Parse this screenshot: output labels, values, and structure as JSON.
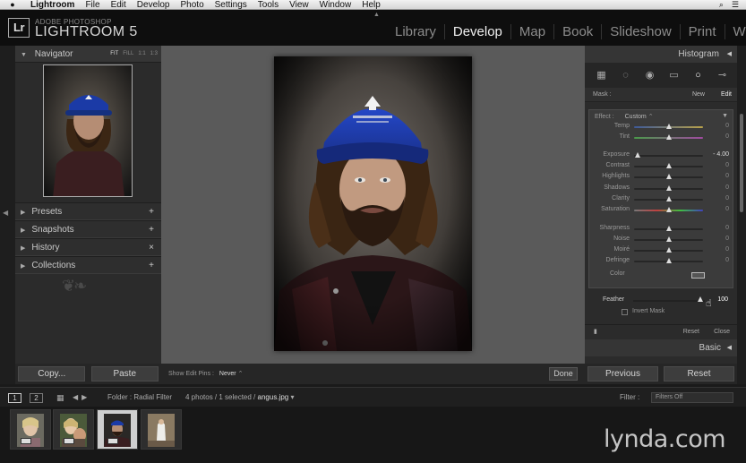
{
  "menubar": {
    "app": "Lightroom",
    "items": [
      "File",
      "Edit",
      "Develop",
      "Photo",
      "Settings",
      "Tools",
      "View",
      "Window",
      "Help"
    ]
  },
  "header": {
    "badge": "Lr",
    "brand_top": "ADOBE PHOTOSHOP",
    "brand_main": "LIGHTROOM 5",
    "modules": [
      {
        "label": "Library",
        "active": false
      },
      {
        "label": "Develop",
        "active": true
      },
      {
        "label": "Map",
        "active": false
      },
      {
        "label": "Book",
        "active": false
      },
      {
        "label": "Slideshow",
        "active": false
      },
      {
        "label": "Print",
        "active": false
      },
      {
        "label": "Web",
        "active": false
      }
    ]
  },
  "left_panel": {
    "navigator": {
      "title": "Navigator",
      "zoom": [
        "FIT",
        "FILL",
        "1:1",
        "1:3"
      ]
    },
    "sections": [
      {
        "label": "Presets",
        "action": "+"
      },
      {
        "label": "Snapshots",
        "action": "+"
      },
      {
        "label": "History",
        "action": "×"
      },
      {
        "label": "Collections",
        "action": "+"
      }
    ],
    "copy_label": "Copy...",
    "paste_label": "Paste"
  },
  "center": {
    "show_pins_label": "Show Edit Pins :",
    "show_pins_value": "Never",
    "done_label": "Done"
  },
  "right_panel": {
    "histogram_title": "Histogram",
    "mask": {
      "label": "Mask :",
      "new": "New",
      "edit": "Edit"
    },
    "effect": {
      "label": "Effect :",
      "value": "Custom"
    },
    "sliders": [
      {
        "label": "Temp",
        "pos": 0.5,
        "value": "0"
      },
      {
        "label": "Tint",
        "pos": 0.5,
        "value": "0"
      },
      {
        "label": "Exposure",
        "pos": 0.05,
        "value": "- 4.00",
        "hi": true
      },
      {
        "label": "Contrast",
        "pos": 0.5,
        "value": "0"
      },
      {
        "label": "Highlights",
        "pos": 0.5,
        "value": "0"
      },
      {
        "label": "Shadows",
        "pos": 0.5,
        "value": "0"
      },
      {
        "label": "Clarity",
        "pos": 0.5,
        "value": "0"
      },
      {
        "label": "Saturation",
        "pos": 0.5,
        "value": "0"
      },
      {
        "label": "Sharpness",
        "pos": 0.5,
        "value": "0"
      },
      {
        "label": "Noise",
        "pos": 0.5,
        "value": "0"
      },
      {
        "label": "Moiré",
        "pos": 0.5,
        "value": "0"
      },
      {
        "label": "Defringe",
        "pos": 0.5,
        "value": "0"
      }
    ],
    "color_label": "Color",
    "feather": {
      "label": "Feather",
      "value": "100"
    },
    "invert_label": "Invert Mask",
    "reset_label": "Reset",
    "close_label": "Close",
    "basic_title": "Basic",
    "previous_label": "Previous",
    "reset_btn_label": "Reset"
  },
  "filmstrip": {
    "page1": "1",
    "page2": "2",
    "folder": "Folder : Radial Filter",
    "count_prefix": "4 photos / 1 selected /",
    "filename": "angus.jpg",
    "filter_label": "Filter :",
    "filter_value": "Filters Off"
  },
  "watermark": "lynda.com"
}
